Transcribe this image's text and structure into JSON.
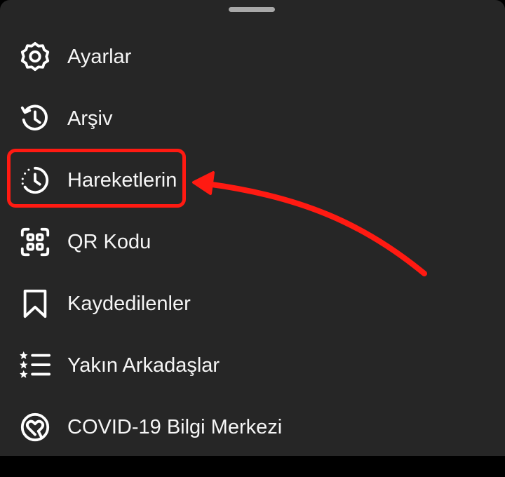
{
  "menu": {
    "items": [
      {
        "label": "Ayarlar",
        "icon": "settings-gear-icon"
      },
      {
        "label": "Arşiv",
        "icon": "archive-history-icon"
      },
      {
        "label": "Hareketlerin",
        "icon": "activity-clock-icon"
      },
      {
        "label": "QR Kodu",
        "icon": "qr-code-icon"
      },
      {
        "label": "Kaydedilenler",
        "icon": "bookmark-icon"
      },
      {
        "label": "Yakın Arkadaşlar",
        "icon": "close-friends-star-list-icon"
      },
      {
        "label": "COVID-19 Bilgi Merkezi",
        "icon": "covid-heart-icon"
      }
    ]
  },
  "annotation": {
    "highlighted_item": "Hareketlerin",
    "color": "#ff1a12"
  },
  "theme": {
    "sheet_background": "#262626",
    "text_color": "#f5f5f5",
    "handle_color": "#a8a8a8"
  }
}
